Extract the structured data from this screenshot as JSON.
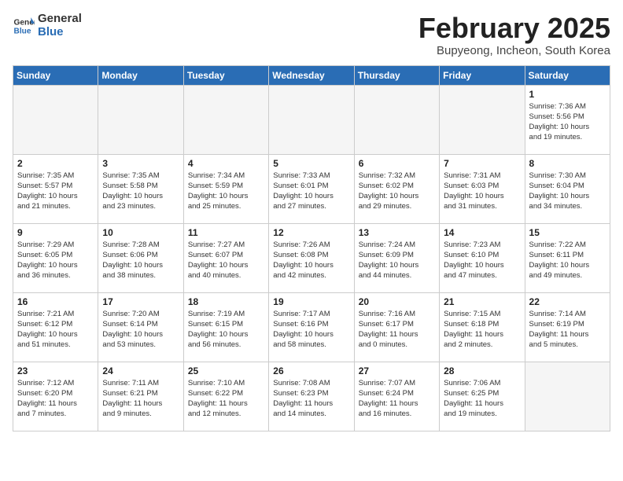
{
  "header": {
    "logo_general": "General",
    "logo_blue": "Blue",
    "title": "February 2025",
    "location": "Bupyeong, Incheon, South Korea"
  },
  "days_of_week": [
    "Sunday",
    "Monday",
    "Tuesday",
    "Wednesday",
    "Thursday",
    "Friday",
    "Saturday"
  ],
  "weeks": [
    [
      {
        "day": "",
        "info": ""
      },
      {
        "day": "",
        "info": ""
      },
      {
        "day": "",
        "info": ""
      },
      {
        "day": "",
        "info": ""
      },
      {
        "day": "",
        "info": ""
      },
      {
        "day": "",
        "info": ""
      },
      {
        "day": "1",
        "info": "Sunrise: 7:36 AM\nSunset: 5:56 PM\nDaylight: 10 hours\nand 19 minutes."
      }
    ],
    [
      {
        "day": "2",
        "info": "Sunrise: 7:35 AM\nSunset: 5:57 PM\nDaylight: 10 hours\nand 21 minutes."
      },
      {
        "day": "3",
        "info": "Sunrise: 7:35 AM\nSunset: 5:58 PM\nDaylight: 10 hours\nand 23 minutes."
      },
      {
        "day": "4",
        "info": "Sunrise: 7:34 AM\nSunset: 5:59 PM\nDaylight: 10 hours\nand 25 minutes."
      },
      {
        "day": "5",
        "info": "Sunrise: 7:33 AM\nSunset: 6:01 PM\nDaylight: 10 hours\nand 27 minutes."
      },
      {
        "day": "6",
        "info": "Sunrise: 7:32 AM\nSunset: 6:02 PM\nDaylight: 10 hours\nand 29 minutes."
      },
      {
        "day": "7",
        "info": "Sunrise: 7:31 AM\nSunset: 6:03 PM\nDaylight: 10 hours\nand 31 minutes."
      },
      {
        "day": "8",
        "info": "Sunrise: 7:30 AM\nSunset: 6:04 PM\nDaylight: 10 hours\nand 34 minutes."
      }
    ],
    [
      {
        "day": "9",
        "info": "Sunrise: 7:29 AM\nSunset: 6:05 PM\nDaylight: 10 hours\nand 36 minutes."
      },
      {
        "day": "10",
        "info": "Sunrise: 7:28 AM\nSunset: 6:06 PM\nDaylight: 10 hours\nand 38 minutes."
      },
      {
        "day": "11",
        "info": "Sunrise: 7:27 AM\nSunset: 6:07 PM\nDaylight: 10 hours\nand 40 minutes."
      },
      {
        "day": "12",
        "info": "Sunrise: 7:26 AM\nSunset: 6:08 PM\nDaylight: 10 hours\nand 42 minutes."
      },
      {
        "day": "13",
        "info": "Sunrise: 7:24 AM\nSunset: 6:09 PM\nDaylight: 10 hours\nand 44 minutes."
      },
      {
        "day": "14",
        "info": "Sunrise: 7:23 AM\nSunset: 6:10 PM\nDaylight: 10 hours\nand 47 minutes."
      },
      {
        "day": "15",
        "info": "Sunrise: 7:22 AM\nSunset: 6:11 PM\nDaylight: 10 hours\nand 49 minutes."
      }
    ],
    [
      {
        "day": "16",
        "info": "Sunrise: 7:21 AM\nSunset: 6:12 PM\nDaylight: 10 hours\nand 51 minutes."
      },
      {
        "day": "17",
        "info": "Sunrise: 7:20 AM\nSunset: 6:14 PM\nDaylight: 10 hours\nand 53 minutes."
      },
      {
        "day": "18",
        "info": "Sunrise: 7:19 AM\nSunset: 6:15 PM\nDaylight: 10 hours\nand 56 minutes."
      },
      {
        "day": "19",
        "info": "Sunrise: 7:17 AM\nSunset: 6:16 PM\nDaylight: 10 hours\nand 58 minutes."
      },
      {
        "day": "20",
        "info": "Sunrise: 7:16 AM\nSunset: 6:17 PM\nDaylight: 11 hours\nand 0 minutes."
      },
      {
        "day": "21",
        "info": "Sunrise: 7:15 AM\nSunset: 6:18 PM\nDaylight: 11 hours\nand 2 minutes."
      },
      {
        "day": "22",
        "info": "Sunrise: 7:14 AM\nSunset: 6:19 PM\nDaylight: 11 hours\nand 5 minutes."
      }
    ],
    [
      {
        "day": "23",
        "info": "Sunrise: 7:12 AM\nSunset: 6:20 PM\nDaylight: 11 hours\nand 7 minutes."
      },
      {
        "day": "24",
        "info": "Sunrise: 7:11 AM\nSunset: 6:21 PM\nDaylight: 11 hours\nand 9 minutes."
      },
      {
        "day": "25",
        "info": "Sunrise: 7:10 AM\nSunset: 6:22 PM\nDaylight: 11 hours\nand 12 minutes."
      },
      {
        "day": "26",
        "info": "Sunrise: 7:08 AM\nSunset: 6:23 PM\nDaylight: 11 hours\nand 14 minutes."
      },
      {
        "day": "27",
        "info": "Sunrise: 7:07 AM\nSunset: 6:24 PM\nDaylight: 11 hours\nand 16 minutes."
      },
      {
        "day": "28",
        "info": "Sunrise: 7:06 AM\nSunset: 6:25 PM\nDaylight: 11 hours\nand 19 minutes."
      },
      {
        "day": "",
        "info": ""
      }
    ]
  ]
}
